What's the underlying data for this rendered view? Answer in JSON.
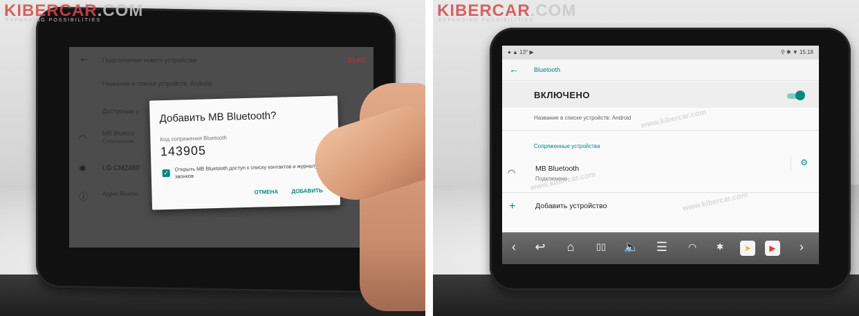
{
  "watermark": {
    "logo_main": "KIBERCAR",
    "logo_suffix": ".COM",
    "tagline": "EXPANDING POSSIBILITIES",
    "overlay_text": "www.kibercar.com"
  },
  "left_screen": {
    "header_title": "Подключение нового устройства",
    "header_action": "ВЫКЛ",
    "device_name_row": "Название в списке устройств: Android",
    "available_label": "Доступные у",
    "paired_device_name": "MB Bluetoo",
    "paired_device_status": "Сопряжение",
    "other_device": "LG CM2460",
    "address_label": "Адрес Bluetoo",
    "dialog": {
      "title": "Добавить MB Bluetooth?",
      "code_label": "Код сопряжения Bluetooth",
      "code": "143905",
      "checkbox_checked": true,
      "checkbox_text": "Открыть MB Bluetooth доступ к списку контактов и журналу звонков",
      "cancel_label": "ОТМЕНА",
      "add_label": "ДОБАВИТЬ"
    }
  },
  "right_screen": {
    "status_left": "13°",
    "status_time": "15:18",
    "appbar_title": "Bluetooth",
    "toggle_label": "ВКЛЮЧЕНО",
    "toggle_on": true,
    "device_name_row": "Название в списке устройств: Android",
    "paired_section_title": "Сопряженные устройства",
    "paired_device_name": "MB Bluetooth",
    "paired_device_status": "Подключено",
    "add_device_label": "Добавить устройство"
  },
  "colors": {
    "accent": "#00897b",
    "watermark_red": "#d44a4a",
    "dim_screen": "#4c4c4c",
    "navbar": "#5c5c5c"
  }
}
